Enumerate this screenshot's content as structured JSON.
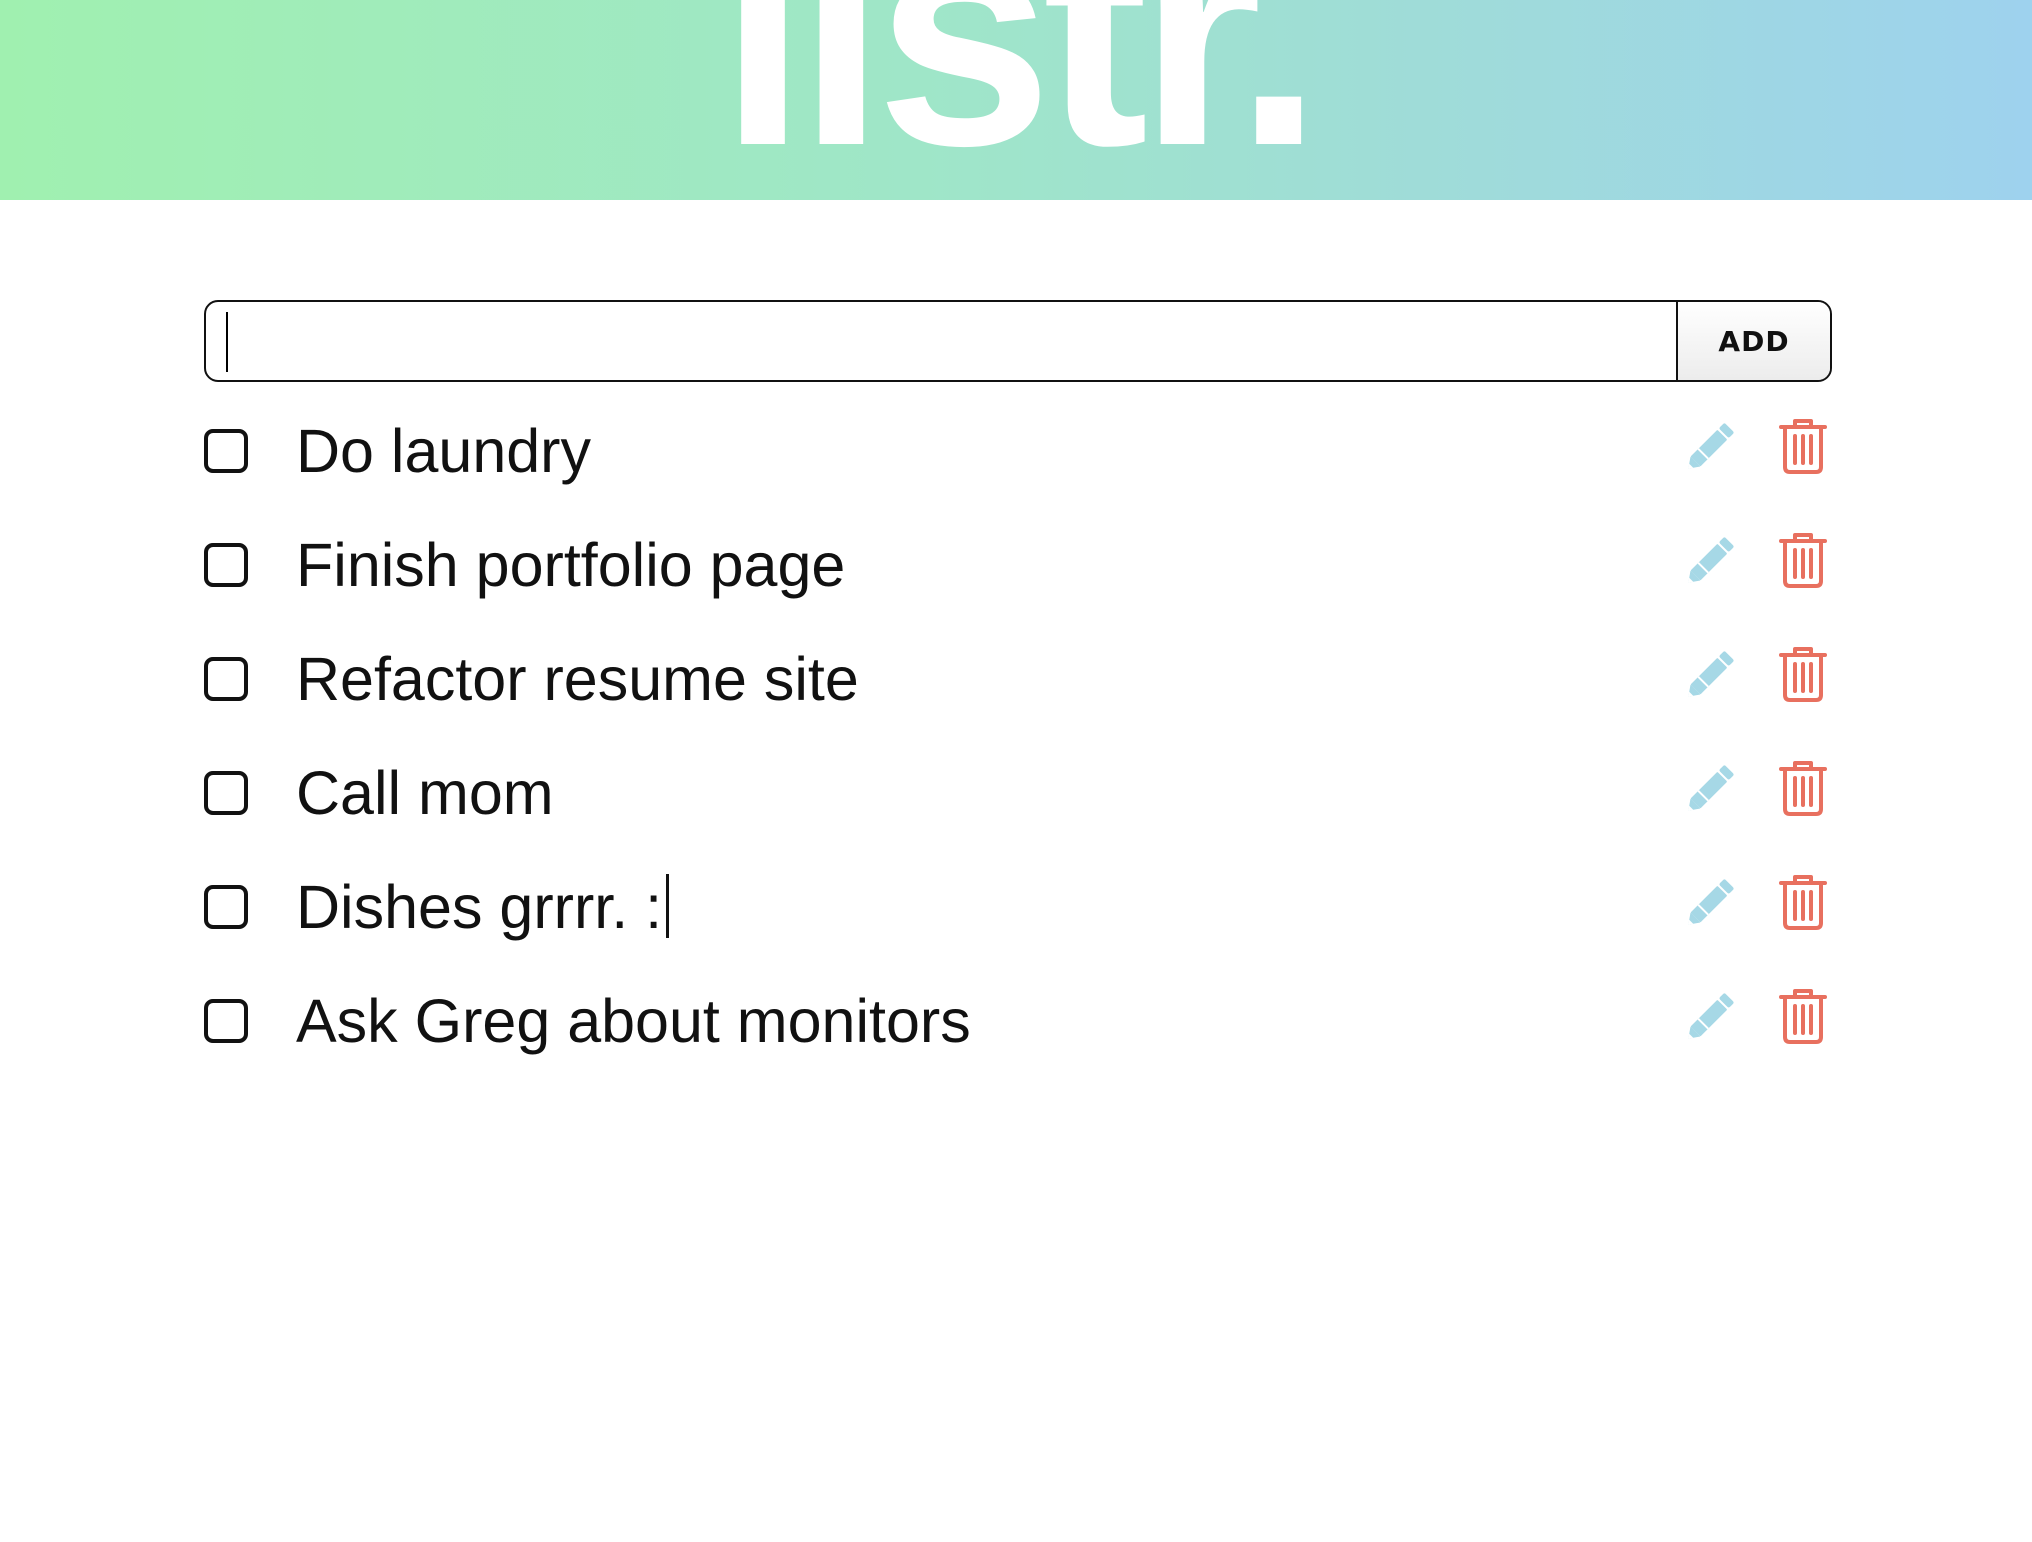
{
  "app": {
    "logo": "listr."
  },
  "add_form": {
    "input_value": "",
    "input_placeholder": "",
    "button_label": "ADD"
  },
  "todos": [
    {
      "text": "Do laundry",
      "checked": false
    },
    {
      "text": "Finish portfolio page",
      "checked": false
    },
    {
      "text": "Refactor resume site",
      "checked": false
    },
    {
      "text": "Call mom",
      "checked": false
    },
    {
      "text": "Dishes grrrr. :",
      "checked": false,
      "editing": true
    },
    {
      "text": "Ask Greg about monitors",
      "checked": false
    }
  ],
  "icons": {
    "edit": "pencil-icon",
    "delete": "trash-icon"
  },
  "colors": {
    "edit_icon": "#a6d8e6",
    "delete_icon": "#e8705f",
    "gradient_start": "#a0f0b0",
    "gradient_end": "#9ed2ee"
  }
}
